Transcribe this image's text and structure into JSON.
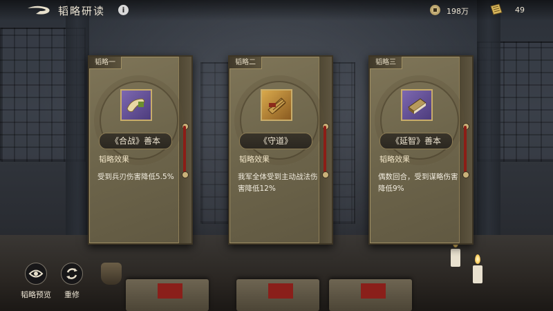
{
  "header": {
    "title": "韬略研读",
    "info_icon": "i",
    "currency": {
      "coins": "198万",
      "scrolls": "49"
    }
  },
  "cards": [
    {
      "tab": "韬略一",
      "name": "《合战》善本",
      "effect_label": "韬略效果",
      "effect_text": "受到兵刃伤害降低5.5%",
      "item_color": "purple",
      "icon": "scroll-icon"
    },
    {
      "tab": "韬略二",
      "name": "《守道》",
      "effect_label": "韬略效果",
      "effect_text": "我军全体受到主动战法伤害降低12%",
      "item_color": "gold",
      "icon": "bamboo-scroll-icon"
    },
    {
      "tab": "韬略三",
      "name": "《延智》善本",
      "effect_label": "韬略效果",
      "effect_text": "偶数回合，受到谋略伤害降低9%",
      "item_color": "purple",
      "icon": "book-icon"
    }
  ],
  "controls": {
    "preview_label": "韬略预览",
    "reroll_label": "重修"
  },
  "colors": {
    "accent_gold": "#c9ad6a",
    "ribbon_red": "#8c1d16"
  }
}
